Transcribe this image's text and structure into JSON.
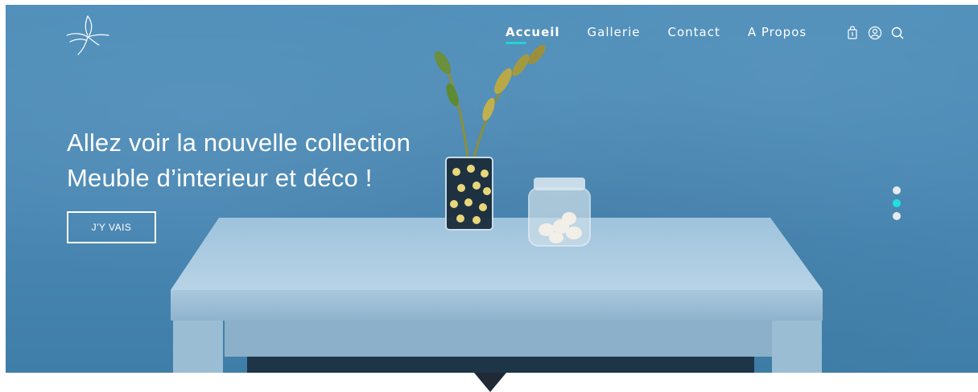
{
  "nav": {
    "items": [
      {
        "label": "Accueil",
        "active": true
      },
      {
        "label": "Gallerie",
        "active": false
      },
      {
        "label": "Contact",
        "active": false
      },
      {
        "label": "A Propos",
        "active": false
      }
    ]
  },
  "header_icons": [
    "shopping-bag-icon",
    "user-icon",
    "search-icon"
  ],
  "hero": {
    "headline_line1": "Allez voir la nouvelle collection",
    "headline_line2": "Meuble d’interieur et déco !",
    "cta_label": "J'Y VAIS"
  },
  "slider": {
    "slide_count": 3,
    "active_index": 1
  },
  "colors": {
    "accent": "#22d4d4",
    "hero_bg": "#4a88b4",
    "dark": "#1f2a36"
  }
}
